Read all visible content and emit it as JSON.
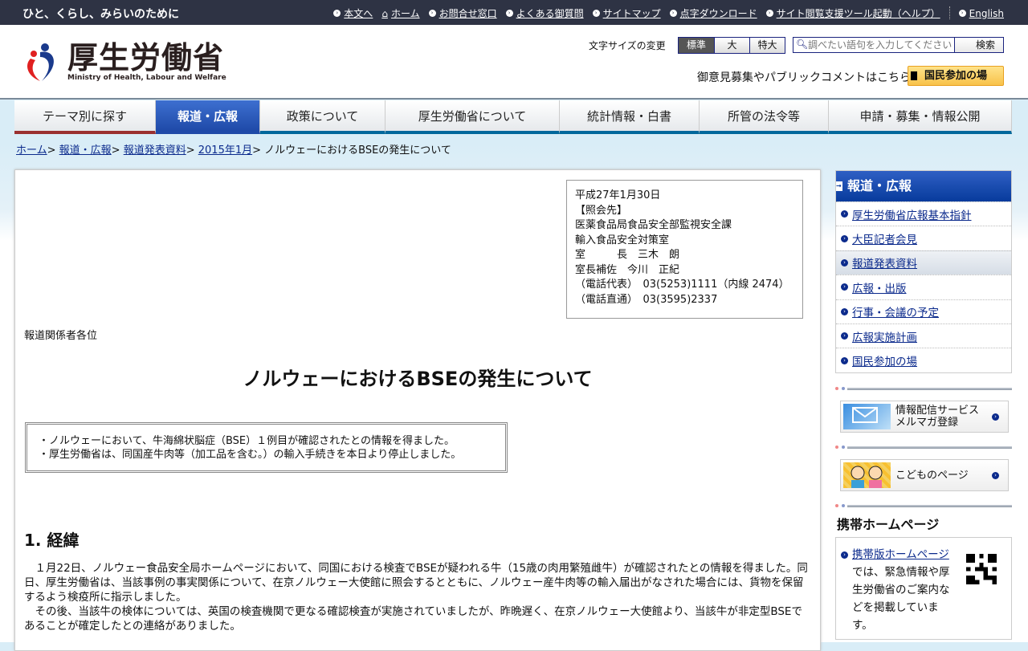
{
  "topbar": {
    "tagline": "ひと、くらし、みらいのために",
    "links": [
      "本文へ",
      "ホーム",
      "お問合せ窓口",
      "よくある御質問",
      "サイトマップ",
      "点字ダウンロード",
      "サイト閲覧支援ツール起動（ヘルプ）",
      "English"
    ]
  },
  "header": {
    "logo_title": "厚生労働省",
    "logo_sub": "Ministry of Health, Labour and Welfare",
    "font_size_label": "文字サイズの変更",
    "font_sizes": [
      "標準",
      "大",
      "特大"
    ],
    "search_placeholder": "調べたい語句を入力してください",
    "search_button": "検索",
    "public_comment": "御意見募集やパブリックコメントはこちら",
    "participation_button": "国民参加の場"
  },
  "nav": [
    "テーマ別に探す",
    "報道・広報",
    "政策について",
    "厚生労働省について",
    "統計情報・白書",
    "所管の法令等",
    "申請・募集・情報公開"
  ],
  "breadcrumb": {
    "items": [
      "ホーム",
      "報道・広報",
      "報道発表資料",
      "2015年1月"
    ],
    "current": "ノルウェーにおけるBSEの発生について"
  },
  "main": {
    "contact": "平成27年1月30日\n【照会先】\n医薬食品局食品安全部監視安全課\n輸入食品安全対策室\n室　　　長　三木　朗\n室長補佐　今川　正紀\n（電話代表）　03(5253)1111（内線 2474）\n（電話直通）　03(3595)2337",
    "addressee": "報道関係者各位",
    "title": "ノルウェーにおけるBSEの発生について",
    "summary": [
      "・ノルウェーにおいて、牛海綿状脳症（BSE）１例目が確認されたとの情報を得ました。",
      "・厚生労働省は、同国産牛肉等（加工品を含む。）の輸入手続きを本日より停止しました。"
    ],
    "section_heading": "1. 経緯",
    "paragraphs": [
      "１月22日、ノルウェー食品安全局ホームページにおいて、同国における検査でBSEが疑われる牛（15歳の肉用繁殖雌牛）が確認されたとの情報を得ました。同日、厚生労働省は、当該事例の事実関係について、在京ノルウェー大使館に照会するとともに、ノルウェー産牛肉等の輸入届出がなされた場合には、貨物を保留するよう検疫所に指示しました。",
      "その後、当該牛の検体については、英国の検査機関で更なる確認検査が実施されていましたが、昨晩遅く、在京ノルウェー大使館より、当該牛が非定型BSEであることが確定したとの連絡がありました。"
    ]
  },
  "sidebar": {
    "heading": "報道・広報",
    "items": [
      "厚生労働省広報基本指針",
      "大臣記者会見",
      "報道発表資料",
      "広報・出版",
      "行事・会議の予定",
      "広報実施計画",
      "国民参加の場"
    ],
    "banner_mail": "情報配信サービス\nメルマガ登録",
    "banner_kids": "こどものページ",
    "mobile_heading": "携帯ホームページ",
    "mobile_link": "携帯版ホームページ",
    "mobile_text": "では、緊急情報や厚生労働省のご案内などを掲載しています。"
  }
}
